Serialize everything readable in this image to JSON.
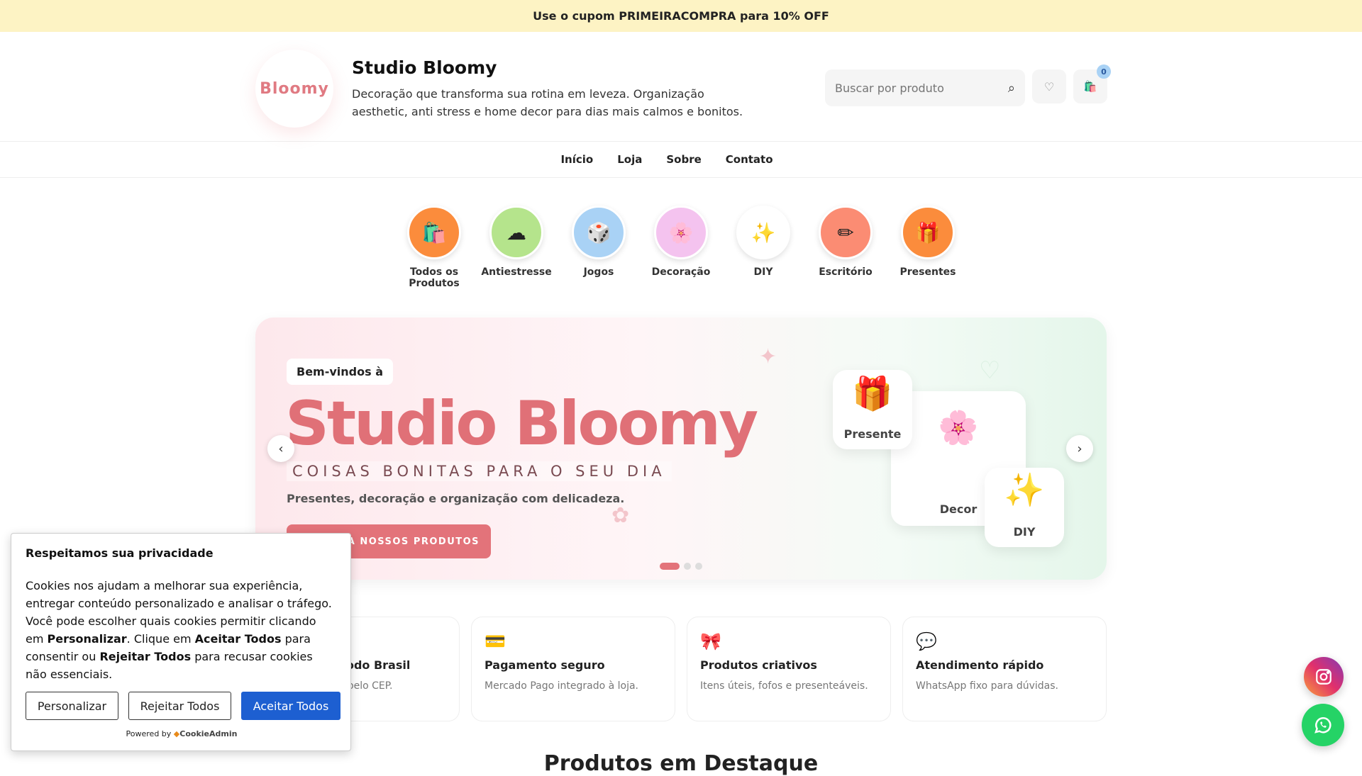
{
  "announcement": "Use o cupom PRIMEIRACOMPRA para 10% OFF",
  "header": {
    "logo_text": "Bloomy",
    "title": "Studio Bloomy",
    "tagline": "Decoração que transforma sua rotina em leveza. Organização aesthetic, anti stress e home decor para dias mais calmos e bonitos.",
    "search_placeholder": "Buscar por produto",
    "cart_count": "0"
  },
  "nav": [
    "Início",
    "Loja",
    "Sobre",
    "Contato"
  ],
  "categories": [
    {
      "label": "Todos os Produtos",
      "icon": "🛍️",
      "color": "#fb8c3c"
    },
    {
      "label": "Antiestresse",
      "icon": "☁",
      "color": "#b5e48c"
    },
    {
      "label": "Jogos",
      "icon": "🎲",
      "color": "#a9d2f5"
    },
    {
      "label": "Decoração",
      "icon": "🌸",
      "color": "#f4c3ef"
    },
    {
      "label": "DIY",
      "icon": "✨",
      "color": "#ffffff"
    },
    {
      "label": "Escritório",
      "icon": "✏",
      "color": "#fb8c73"
    },
    {
      "label": "Presentes",
      "icon": "🎁",
      "color": "#fb8c3c"
    }
  ],
  "hero": {
    "welcome": "Bem-vindos à",
    "title": "Studio Bloomy",
    "tagline": "COISAS BONITAS PARA O SEU DIA",
    "subtitle": "Presentes, decoração e organização com delicadeza.",
    "cta": "CONHEÇA NOSSOS PRODUTOS",
    "cards": [
      {
        "label": "Presente",
        "icon": "🎁"
      },
      {
        "label": "Decor",
        "icon": "🌸"
      },
      {
        "label": "DIY",
        "icon": "✨"
      }
    ],
    "slides": 3,
    "active_slide": 1
  },
  "features": [
    {
      "icon": "🚚",
      "title": "Envio para todo Brasil",
      "desc": "Frete calculado pelo CEP."
    },
    {
      "icon": "💳",
      "title": "Pagamento seguro",
      "desc": "Mercado Pago integrado à loja."
    },
    {
      "icon": "🎀",
      "title": "Produtos criativos",
      "desc": "Itens úteis, fofos e presenteáveis."
    },
    {
      "icon": "💬",
      "title": "Atendimento rápido",
      "desc": "WhatsApp fixo para dúvidas."
    }
  ],
  "section_title": "Produtos em Destaque",
  "cookie": {
    "title": "Respeitamos sua privacidade",
    "body_1": "Cookies nos ajudam a melhorar sua experiência, entregar conteúdo personalizado e analisar o tráfego. Você pode escolher quais cookies permitir clicando em ",
    "customize_bold": "Personalizar",
    "body_2": ". Clique em ",
    "accept_bold": "Aceitar Todos",
    "body_3": " para consentir ou ",
    "reject_bold": "Rejeitar Todos",
    "body_4": " para recusar cookies não essenciais.",
    "btn_customize": "Personalizar",
    "btn_reject": "Rejeitar Todos",
    "btn_accept": "Aceitar Todos",
    "powered_by": "Powered by",
    "powered_brand": "CookieAdmin"
  },
  "colors": {
    "accent": "#e3737a",
    "announcement_bg": "#fdf3c4",
    "accept_button": "#1d5fd1",
    "whatsapp": "#25d366"
  }
}
